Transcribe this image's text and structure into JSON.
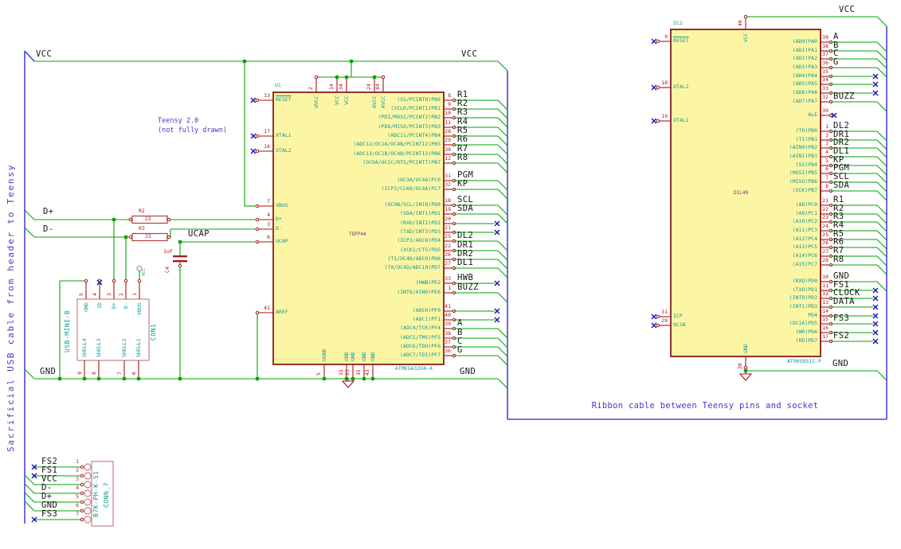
{
  "annotations": {
    "teensy_note_line1": "Teensy 2.0",
    "teensy_note_line2": "(not fully drawn)",
    "usb_cable_note": "Sacrificial USB cable from header to Teensy",
    "ribbon_note": "Ribbon cable between Teensy pins and socket"
  },
  "nets": {
    "vcc": "VCC",
    "gnd": "GND",
    "dplus": "D+",
    "dminus": "D-",
    "ucap": "UCAP"
  },
  "components": {
    "u1": {
      "ref": "U1",
      "value": "ATMEGA32U4-A",
      "footprint": "TQFP44",
      "left_pins": [
        {
          "num": "13",
          "name": "RESET",
          "nc": true,
          "ov": true
        },
        {
          "num": "17",
          "name": "XTAL1",
          "nc": true
        },
        {
          "num": "16",
          "name": "XTAL2",
          "nc": true
        },
        {
          "num": "7",
          "name": "VBUS"
        },
        {
          "num": "4",
          "name": "D+"
        },
        {
          "num": "3",
          "name": "D-"
        },
        {
          "num": "6",
          "name": "UCAP"
        },
        {
          "num": "42",
          "name": "AREF"
        }
      ],
      "right_pins": [
        {
          "num": "8",
          "name": "(SS/PCINT0)PB0",
          "label": "R1"
        },
        {
          "num": "9",
          "name": "(SCLK/PCINT1)PB1",
          "label": "R2"
        },
        {
          "num": "10",
          "name": "(PDI/MOSI/PCINT2)PB2",
          "label": "R3"
        },
        {
          "num": "11",
          "name": "(PDO/MISO/PCINT3)PB3",
          "label": "R4"
        },
        {
          "num": "28",
          "name": "(ADC11/PCINT4)PB4",
          "label": "R5"
        },
        {
          "num": "29",
          "name": "(ADC12/OC1A/OC4B/PCINT12)PB5",
          "label": "R6"
        },
        {
          "num": "30",
          "name": "(ADC13/OC1B/OC4B/PCINT13)PB6",
          "label": "R7"
        },
        {
          "num": "12",
          "name": "(OC0A/OC1C/RTS/PCINT7)PB7",
          "label": "R8"
        },
        {
          "num": "31",
          "name": "(OC3A/OC4A)PC6",
          "label": "PGM"
        },
        {
          "num": "32",
          "name": "(ICP3/CLK0/OC4A)PC7",
          "label": "KP"
        },
        {
          "num": "18",
          "name": "(OC0B/SCL/INT0)PD0",
          "label": "SCL"
        },
        {
          "num": "19",
          "name": "(SDA/INT1)PD1",
          "label": "SDA"
        },
        {
          "num": "20",
          "name": "(RXD/INT2)PD2",
          "nc": true
        },
        {
          "num": "21",
          "name": "(TXD/INT3)PD3",
          "nc": true
        },
        {
          "num": "25",
          "name": "(ICP2/ADC8)PD4",
          "label": "DL2"
        },
        {
          "num": "22",
          "name": "(XCK1/CTS)PD5",
          "label": "DR1"
        },
        {
          "num": "26",
          "name": "(T1/OC4D/ADC9)PD6",
          "label": "DR2"
        },
        {
          "num": "27",
          "name": "(T0/OC4D/ADC10)PD7",
          "label": "DL1"
        },
        {
          "num": "33",
          "name": "(HWB)PE2",
          "label": "HWB",
          "nc": true
        },
        {
          "num": "1",
          "name": "(INT6/AIN0)PE6",
          "label": "BUZZ"
        },
        {
          "num": "41",
          "name": "(ADC0)PF0",
          "nc": true
        },
        {
          "num": "40",
          "name": "(ADC1)PF1",
          "nc": true
        },
        {
          "num": "39",
          "name": "(ADC4/TCK)PF4",
          "label": "A"
        },
        {
          "num": "38",
          "name": "(ADC5/TMS)PF5",
          "label": "B"
        },
        {
          "num": "37",
          "name": "(ADC6/TDO)PF6",
          "label": "C"
        },
        {
          "num": "36",
          "name": "(ADC7/TDI)PF7",
          "label": "G"
        }
      ],
      "top_pins": [
        {
          "num": "2",
          "name": "UVCC"
        },
        {
          "num": "14",
          "name": "VCC"
        },
        {
          "num": "34",
          "name": "VCC"
        },
        {
          "num": "24",
          "name": "AVCC"
        },
        {
          "num": "44",
          "name": "AVCC"
        }
      ],
      "bottom_pins": [
        {
          "num": "5",
          "name": "UGND"
        },
        {
          "num": "15",
          "name": "GND"
        },
        {
          "num": "23",
          "name": "GND"
        },
        {
          "num": "35",
          "name": "GND"
        },
        {
          "num": "43",
          "name": "GND"
        }
      ]
    },
    "ic2": {
      "ref": "IC2",
      "value": "AT90S8515-P",
      "footprint": "DIL40",
      "left_pins": [
        {
          "num": "9",
          "name": "RESET",
          "nc": true,
          "ov": true
        },
        {
          "num": "18",
          "name": "XTAL2",
          "nc": true
        },
        {
          "num": "19",
          "name": "XTAL1",
          "nc": true
        },
        {
          "num": "31",
          "name": "ICP",
          "nc": true
        },
        {
          "num": "29",
          "name": "OC1B",
          "nc": true
        }
      ],
      "right_pins": [
        {
          "num": "39",
          "name": "(AD0)PA0",
          "label": "A"
        },
        {
          "num": "38",
          "name": "(AD1)PA1",
          "label": "B"
        },
        {
          "num": "37",
          "name": "(AD2)PA2",
          "label": "C"
        },
        {
          "num": "36",
          "name": "(AD3)PA3",
          "label": "G"
        },
        {
          "num": "35",
          "name": "(AD4)PA4",
          "nc": true
        },
        {
          "num": "34",
          "name": "(AD5)PA5",
          "nc": true
        },
        {
          "num": "33",
          "name": "(AD6)PA6",
          "nc": true
        },
        {
          "num": "32",
          "name": "(AD7)PA7",
          "label": "BUZZ"
        },
        {
          "num": "30",
          "name": "ALE",
          "nc": true,
          "short": true
        },
        {
          "num": "1",
          "name": "(T0)PB0",
          "label": "DL2"
        },
        {
          "num": "2",
          "name": "(T1)PB1",
          "label": "DR1"
        },
        {
          "num": "3",
          "name": "(AIN0)PB2",
          "label": "DR2"
        },
        {
          "num": "4",
          "name": "(AIN1)PB3",
          "label": "DL1"
        },
        {
          "num": "5",
          "name": "(SS)PB4",
          "label": "KP"
        },
        {
          "num": "6",
          "name": "(MOSI)PB5",
          "label": "PGM"
        },
        {
          "num": "7",
          "name": "(MISO)PB6",
          "label": "SCL"
        },
        {
          "num": "8",
          "name": "(SCK)PB7",
          "label": "SDA"
        },
        {
          "num": "21",
          "name": "(A8)PC0",
          "label": "R1"
        },
        {
          "num": "22",
          "name": "(A9)PC1",
          "label": "R2"
        },
        {
          "num": "23",
          "name": "(A10)PC2",
          "label": "R3"
        },
        {
          "num": "24",
          "name": "(A11)PC3",
          "label": "R4"
        },
        {
          "num": "25",
          "name": "(A12)PC4",
          "label": "R5"
        },
        {
          "num": "26",
          "name": "(A13)PC5",
          "label": "R6"
        },
        {
          "num": "27",
          "name": "(A14)PC6",
          "label": "R7"
        },
        {
          "num": "28",
          "name": "(A15)PC7",
          "label": "R8"
        },
        {
          "num": "10",
          "name": "(RXD)PD0",
          "label": "GND"
        },
        {
          "num": "11",
          "name": "(TXD)PD1",
          "label": "FS1",
          "nc": true
        },
        {
          "num": "12",
          "name": "(INT0)PD2",
          "label": "CLOCK",
          "nc": true
        },
        {
          "num": "13",
          "name": "(INT1)PD3",
          "label": "DATA",
          "nc": true
        },
        {
          "num": "14",
          "name": "PD4",
          "nc": true
        },
        {
          "num": "15",
          "name": "(OC1A)PD5",
          "label": "FS3",
          "nc": true
        },
        {
          "num": "16",
          "name": "(WR)PD6",
          "nc": true
        },
        {
          "num": "17",
          "name": "(RD)PD7",
          "label": "FS2",
          "nc": true
        }
      ],
      "top_pins": [
        {
          "num": "40",
          "name": "VCC"
        }
      ],
      "bottom_pins": [
        {
          "num": "20",
          "name": "GND"
        }
      ]
    },
    "con1": {
      "ref": "CON1",
      "value": "USB-MINI-B",
      "top_pins": [
        {
          "num": "5",
          "name": "GND"
        },
        {
          "num": "4",
          "name": "ID",
          "nc": true
        },
        {
          "num": "3",
          "name": "D+"
        },
        {
          "num": "2",
          "name": "D-"
        },
        {
          "num": "1",
          "name": "VBUS"
        }
      ],
      "bottom_pins": [
        {
          "num": "9",
          "name": "SHELL4"
        },
        {
          "num": "8",
          "name": "SHELL3"
        },
        {
          "num": "7",
          "name": "SHELL2"
        },
        {
          "num": "6",
          "name": "SHELL1"
        }
      ]
    },
    "conn7": {
      "ref": "CONN_7",
      "value": "B7K-PH-K-S1",
      "pins": [
        {
          "num": "1",
          "label": "FS2",
          "nc": true
        },
        {
          "num": "2",
          "label": "FS1",
          "nc": true
        },
        {
          "num": "3",
          "label": "VCC"
        },
        {
          "num": "4",
          "label": "D-"
        },
        {
          "num": "5",
          "label": "D+"
        },
        {
          "num": "6",
          "label": "GND"
        },
        {
          "num": "7",
          "label": "FS3",
          "nc": true
        }
      ]
    },
    "r2": {
      "ref": "R2",
      "value": "22"
    },
    "r3": {
      "ref": "R3",
      "value": "22"
    },
    "c4": {
      "ref": "C4",
      "value": "1uF"
    },
    "usb_power_flag": "VCC"
  },
  "colors": {
    "wire_green": "#00A400",
    "component_dark_red": "#8B1A1A",
    "component_light_red": "#C98383",
    "pin_red": "#A51515",
    "body_yellow": "#FCF6A4",
    "field_teal": "#0E9898",
    "footprint_purple": "#86258A",
    "annotation_blue": "#3C3CC8",
    "noconnect_blue": "#1414B4",
    "net_label_black": "#141414"
  }
}
